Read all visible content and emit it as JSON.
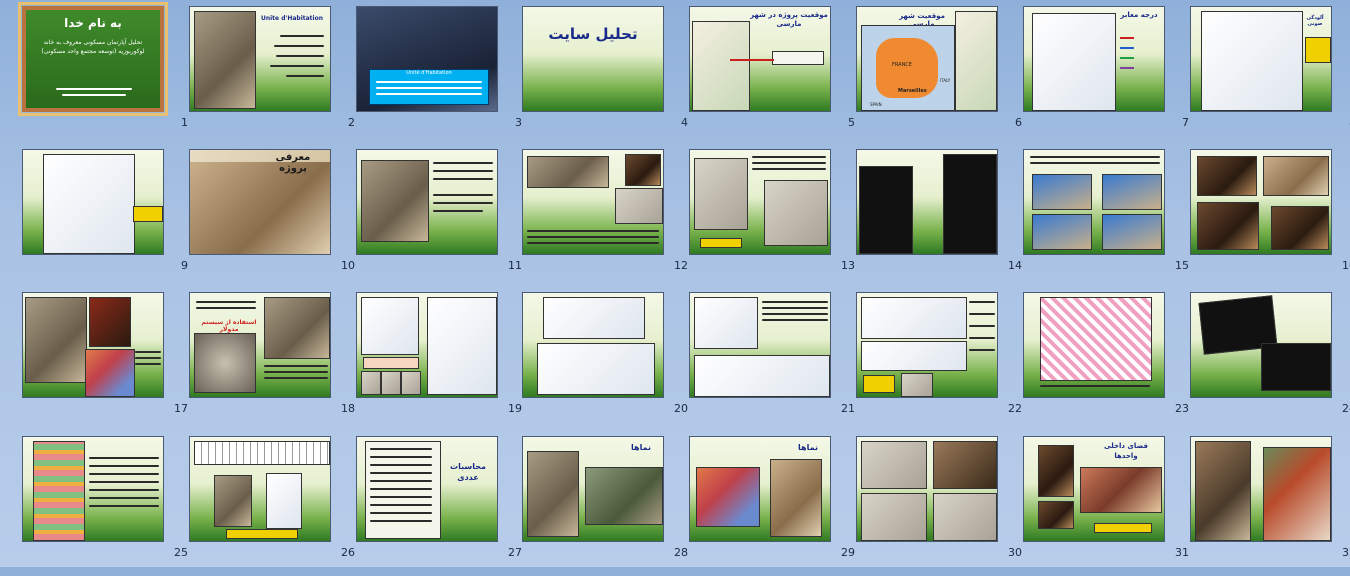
{
  "app": "PowerPoint Slide Sorter",
  "slides": [
    {
      "num": "1",
      "title": "به نام خدا",
      "subtitle": "تحلیل آپارتمان مسکونی معروف به خانه لوکوربوزیه (توسعه مجتمع واحد مسکونی)",
      "theme": "brown"
    },
    {
      "num": "2",
      "title": "Unite d'Habitation"
    },
    {
      "num": "3",
      "title": "Unité d'Habitation"
    },
    {
      "num": "4",
      "title": "تحلیل سایت"
    },
    {
      "num": "5",
      "title": "موقعیت پروژه در شهر مارسی"
    },
    {
      "num": "6",
      "title": "موقعیت شهر مارسی",
      "map_labels": [
        "FRANCE",
        "Marseilles",
        "SPAIN",
        "ITALY"
      ]
    },
    {
      "num": "7",
      "title": "درجه معابر"
    },
    {
      "num": "8",
      "title": "آلودگی صوتی"
    },
    {
      "num": "9",
      "title": ""
    },
    {
      "num": "10",
      "title": "معرفی پروژه"
    },
    {
      "num": "11",
      "title": ""
    },
    {
      "num": "12",
      "title": ""
    },
    {
      "num": "13",
      "title": ""
    },
    {
      "num": "14",
      "title": ""
    },
    {
      "num": "15",
      "title": ""
    },
    {
      "num": "16",
      "title": ""
    },
    {
      "num": "17",
      "title": ""
    },
    {
      "num": "18",
      "title": "استفاده از سیستم مدولار"
    },
    {
      "num": "19",
      "title": ""
    },
    {
      "num": "20",
      "title": ""
    },
    {
      "num": "21",
      "title": ""
    },
    {
      "num": "22",
      "title": ""
    },
    {
      "num": "23",
      "title": ""
    },
    {
      "num": "24",
      "title": ""
    },
    {
      "num": "25",
      "title": ""
    },
    {
      "num": "26",
      "title": ""
    },
    {
      "num": "27",
      "title": "محاسبات عددی"
    },
    {
      "num": "28",
      "title": "نماها"
    },
    {
      "num": "29",
      "title": "نماها"
    },
    {
      "num": "30",
      "title": ""
    },
    {
      "num": "31",
      "title": "فضای داخلی واحدها"
    },
    {
      "num": "32",
      "title": ""
    }
  ],
  "colors": {
    "accent": "#e8c070",
    "title_blue": "#1a2a8a",
    "theme_green": "#2f7a22"
  }
}
